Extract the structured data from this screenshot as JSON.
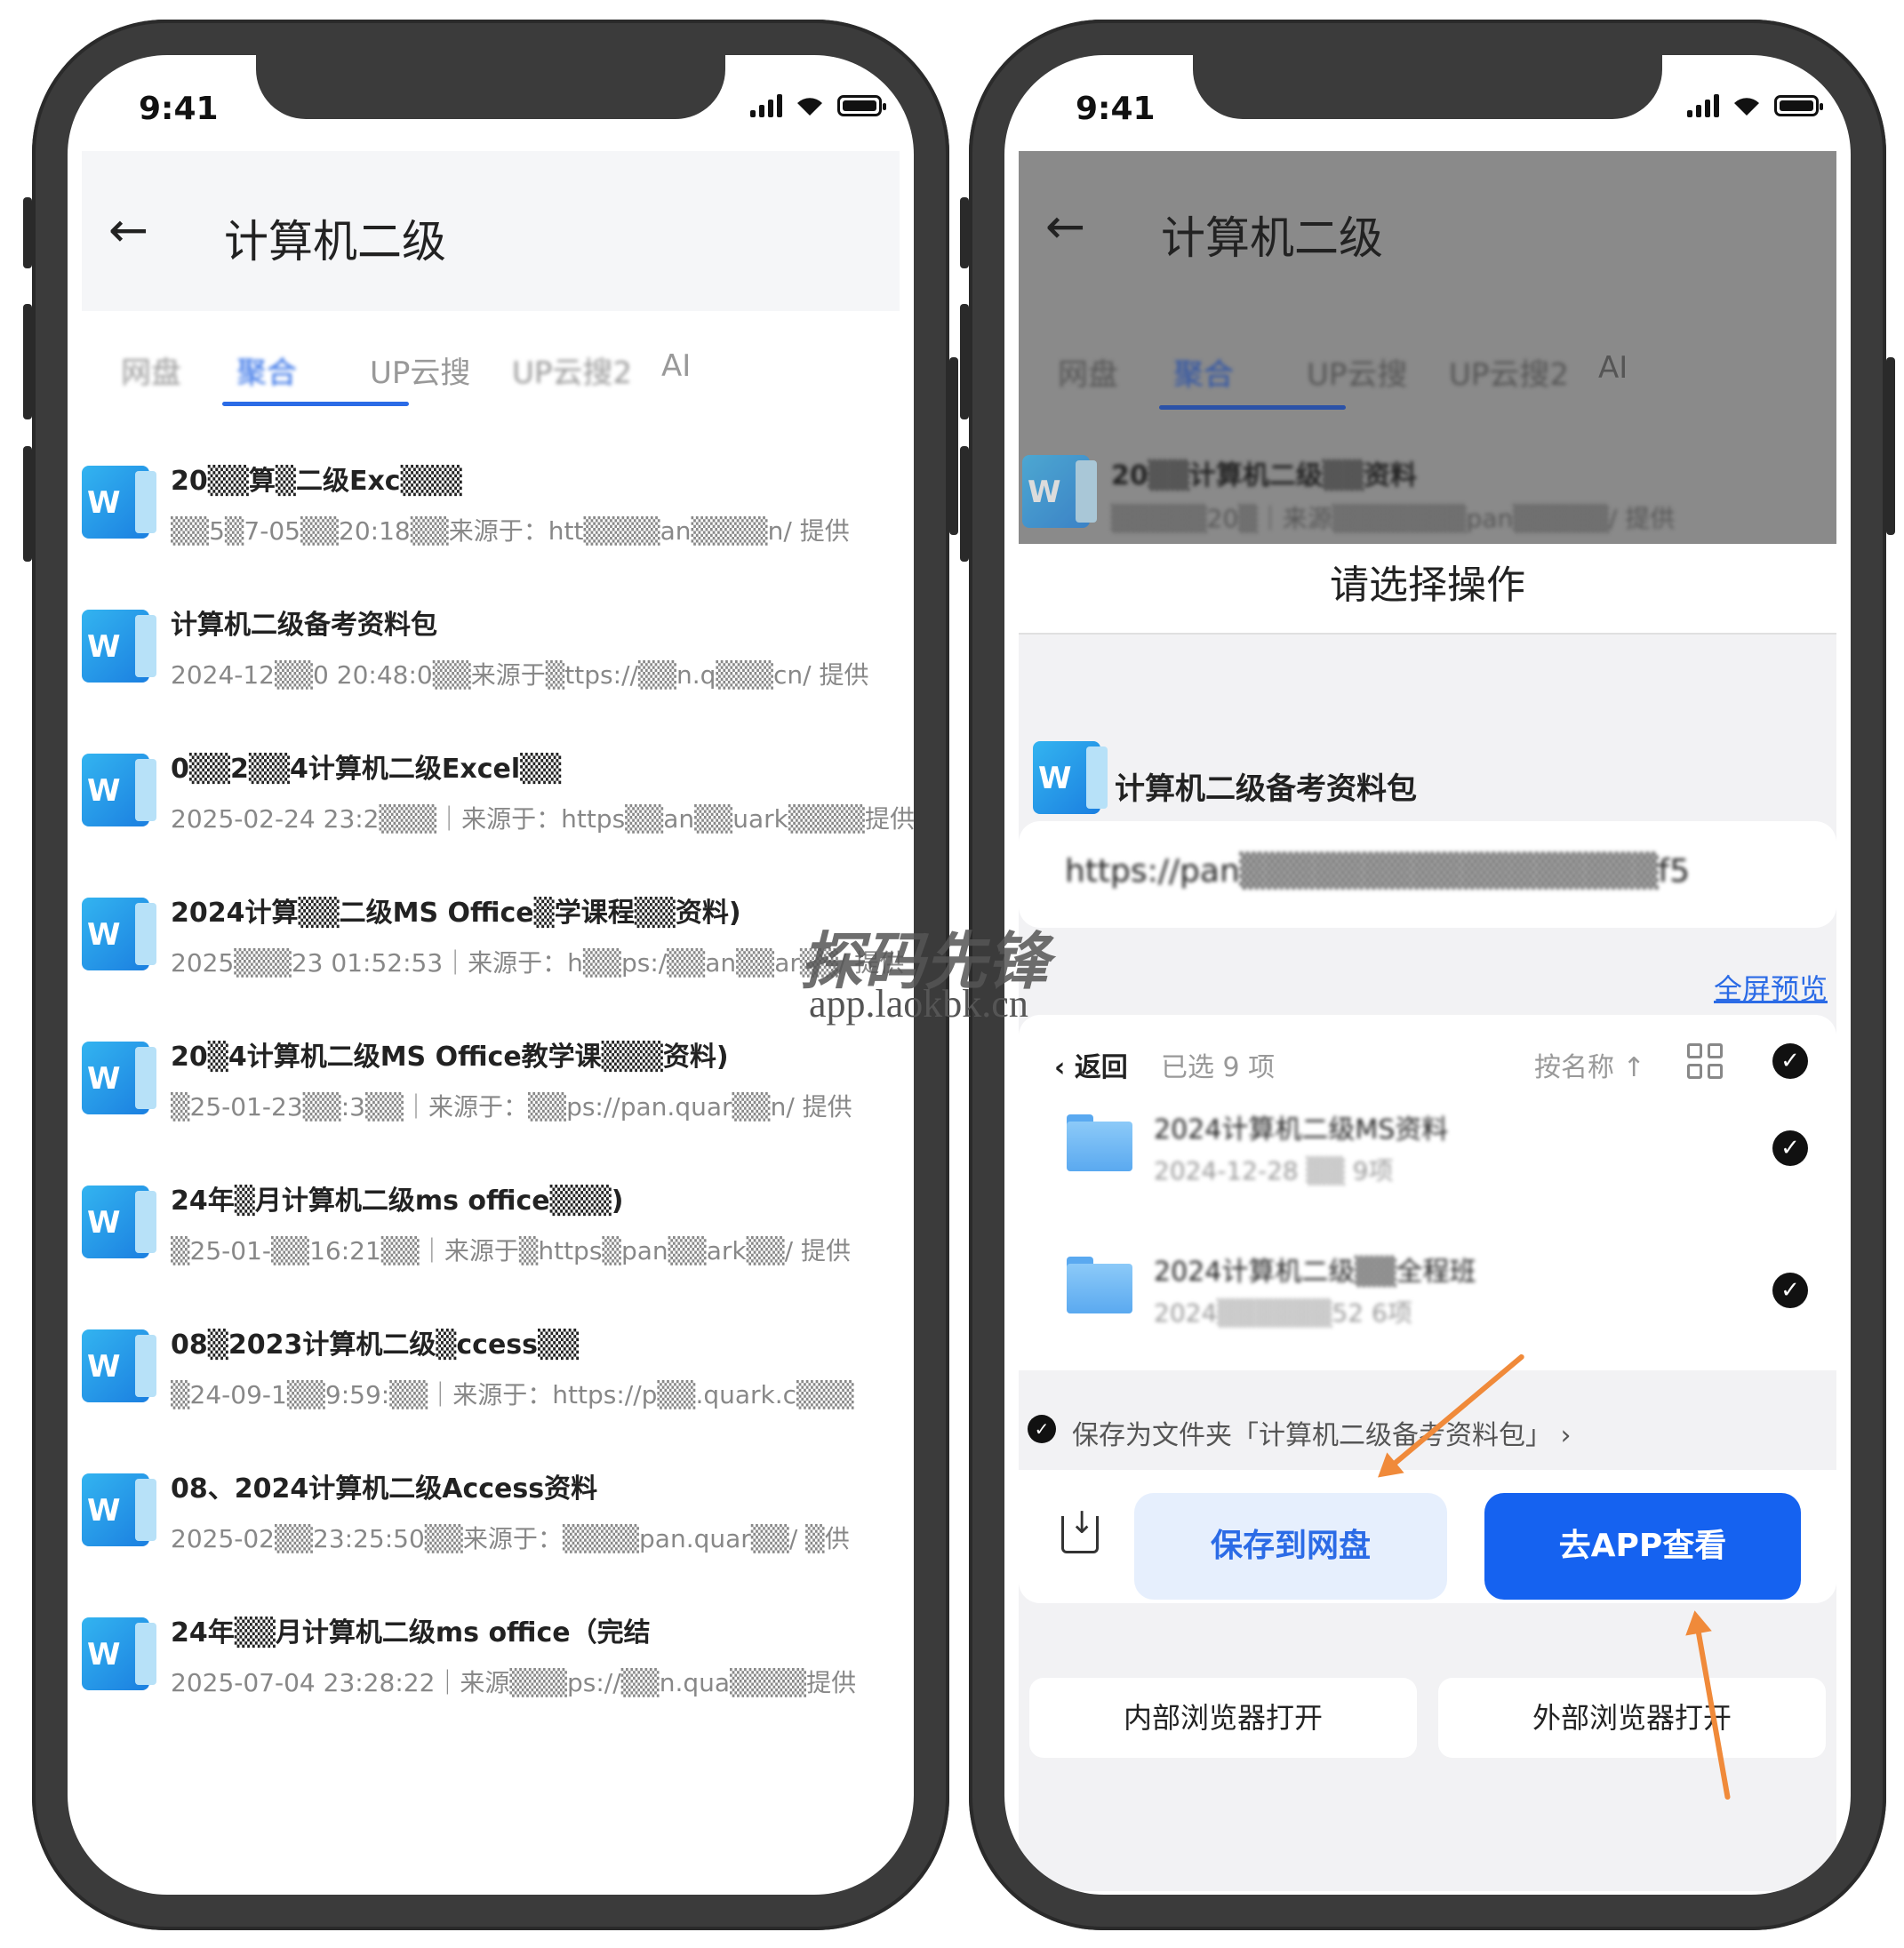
{
  "status": {
    "time": "9:41"
  },
  "left": {
    "title": "计算机二级",
    "tabs": [
      "网盘",
      "聚合",
      "UP云搜",
      "UP云搜2",
      "AI"
    ],
    "items": [
      {
        "title": "20▒▒算▒二级Exc▒▒▒",
        "meta": "▒▒5▒7-05▒▒20:18▒▒来源于：htt▒▒▒▒an▒▒▒▒n/ 提供"
      },
      {
        "title": "计算机二级备考资料包",
        "meta": "2024-12▒▒0 20:48:0▒▒来源于▒ttps://▒▒n.q▒▒▒cn/ 提供"
      },
      {
        "title": "0▒▒2▒▒4计算机二级Excel▒▒",
        "meta": "2025-02-24 23:2▒▒▒｜来源于：https▒▒an▒▒uark▒▒▒▒提供"
      },
      {
        "title": "2024计算▒▒二级MS Office▒学课程▒▒资料)",
        "meta": "2025▒▒▒23 01:52:53｜来源于：h▒▒ps:/▒▒an▒▒ar▒▒/ 提供"
      },
      {
        "title": "20▒4计算机二级MS Office教学课▒▒▒资料)",
        "meta": "▒25-01-23▒▒:3▒▒｜来源于：▒▒ps://pan.quar▒▒n/ 提供"
      },
      {
        "title": "24年▒月计算机二级ms office▒▒▒)",
        "meta": "▒25-01-▒▒16:21▒▒｜来源于▒https▒pan▒▒ark▒▒/ 提供"
      },
      {
        "title": "08▒2023计算机二级▒ccess▒▒",
        "meta": "▒24-09-1▒▒9:59:▒▒｜来源于：https://p▒▒.quark.c▒▒▒"
      },
      {
        "title": "08、2024计算机二级Access资料",
        "meta": "2025-02▒▒23:25:50▒▒来源于：▒▒▒▒pan.quar▒▒/ ▒供"
      },
      {
        "title": "24年▒▒月计算机二级ms office（完结",
        "meta": "2025-07-04 23:28:22｜来源▒▒▒ps://▒▒n.qua▒▒▒▒提供"
      }
    ]
  },
  "right": {
    "title": "计算机二级",
    "tabs": [
      "网盘",
      "聚合",
      "UP云搜",
      "UP云搜2",
      "AI"
    ],
    "overlay_item": {
      "title": "20▒▒计算机二级▒▒资料",
      "meta": "▒▒▒▒▒20▒｜来源▒▒▒▒▒▒▒pan▒▒▒▒▒/ 提供"
    },
    "sheet_title": "请选择操作",
    "package_title": "计算机二级备考资料包",
    "url": "https://pan▒▒▒▒▒▒▒▒▒▒▒▒▒▒▒▒▒f5",
    "full_preview": "全屏预览",
    "back": "返回",
    "selected": "已选 9 项",
    "sort": "按名称 ↑",
    "folders": [
      {
        "name": "2024计算机二级MS资料",
        "meta": "2024-12-28 ▒▒ 9项"
      },
      {
        "name": "2024计算机二级▒▒全程班",
        "meta": "2024▒▒▒▒▒▒52 6项"
      }
    ],
    "save_folder": "保存为文件夹「计算机二级备考资料包」 ›",
    "save_button": "保存到网盘",
    "app_button": "去APP查看",
    "internal_browser": "内部浏览器打开",
    "external_browser": "外部浏览器打开"
  },
  "watermark": {
    "name": "探码先锋",
    "url": "app.laokbk.cn"
  },
  "colors": {
    "accent": "#2b6be6",
    "primary_button": "#1562f0",
    "arrow": "#f08a3a"
  }
}
